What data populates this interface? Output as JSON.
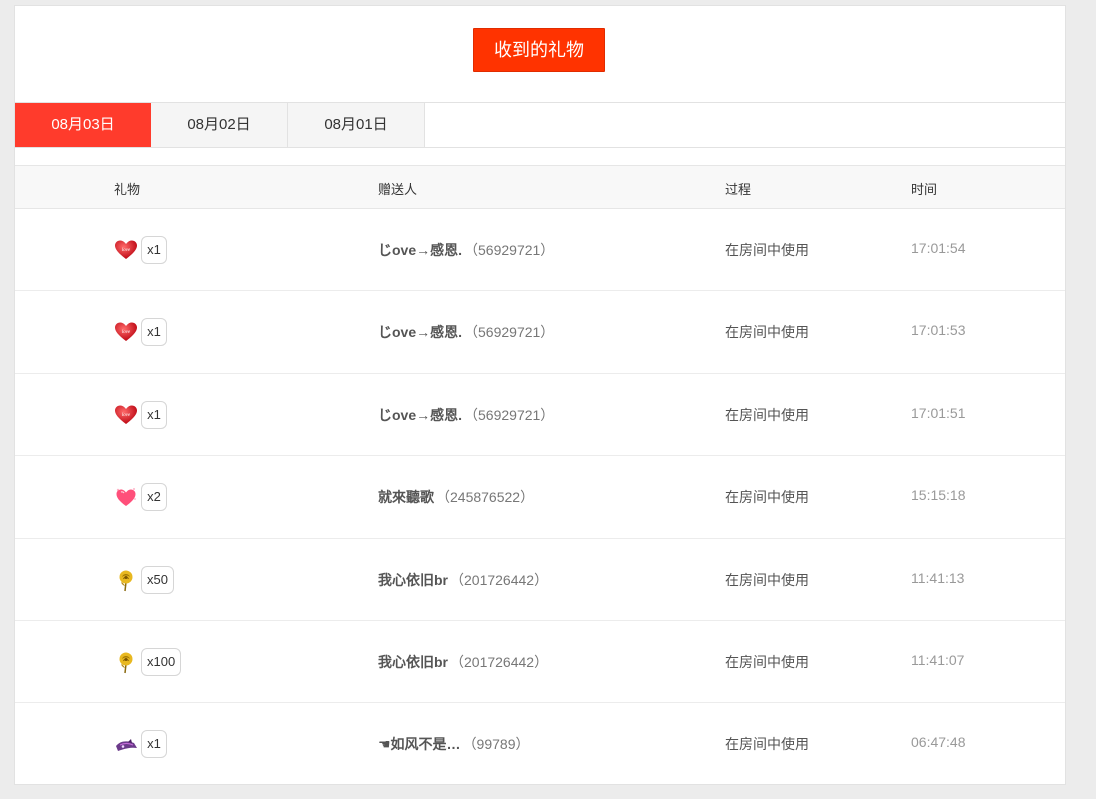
{
  "title_button": "收到的礼物",
  "tabs": [
    "08月03日",
    "08月02日",
    "08月01日"
  ],
  "active_tab": 0,
  "columns": {
    "gift": "礼物",
    "sender": "赠送人",
    "process": "过程",
    "time": "时间"
  },
  "rows": [
    {
      "gift_icon": "love-heart-icon",
      "qty": "x1",
      "sender_name": "じove→感恩.",
      "sender_id": "（56929721）",
      "process": "在房间中使用",
      "time": "17:01:54"
    },
    {
      "gift_icon": "love-heart-icon",
      "qty": "x1",
      "sender_name": "じove→感恩.",
      "sender_id": "（56929721）",
      "process": "在房间中使用",
      "time": "17:01:53"
    },
    {
      "gift_icon": "love-heart-icon",
      "qty": "x1",
      "sender_name": "じove→感恩.",
      "sender_id": "（56929721）",
      "process": "在房间中使用",
      "time": "17:01:51"
    },
    {
      "gift_icon": "pink-heart-icon",
      "qty": "x2",
      "sender_name": "就來聽歌",
      "sender_id": "（245876522）",
      "process": "在房间中使用",
      "time": "15:15:18"
    },
    {
      "gift_icon": "gold-rose-icon",
      "qty": "x50",
      "sender_name": "我心依旧br",
      "sender_id": "（201726442）",
      "process": "在房间中使用",
      "time": "11:41:13"
    },
    {
      "gift_icon": "gold-rose-icon",
      "qty": "x100",
      "sender_name": "我心依旧br",
      "sender_id": "（201726442）",
      "process": "在房间中使用",
      "time": "11:41:07"
    },
    {
      "gift_icon": "purple-gift-icon",
      "qty": "x1",
      "sender_name": "☚如风不是…",
      "sender_id": "（99789）",
      "process": "在房间中使用",
      "time": "06:47:48"
    }
  ]
}
